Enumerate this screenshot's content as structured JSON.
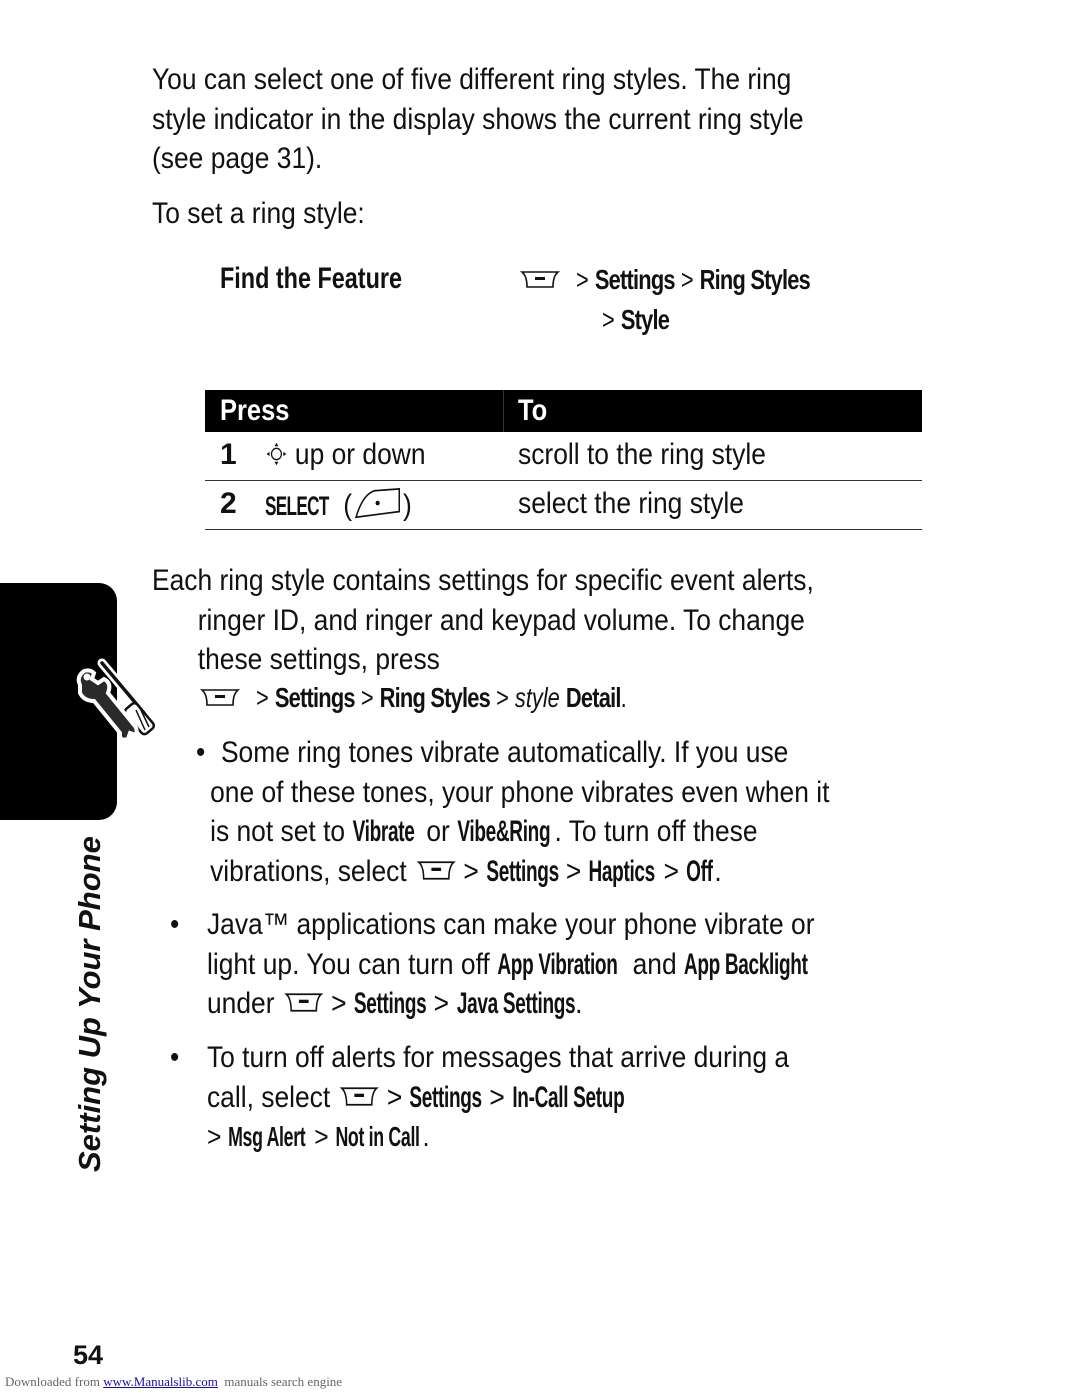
{
  "intro": {
    "lines": [
      "You can select one of five different ring styles. The ring",
      "style indicator in the display shows the current ring style",
      "(see page 31)."
    ],
    "lead": "To set a ring style:"
  },
  "find_feature": {
    "label": "Find the Feature",
    "menu_icon": "menu-key-icon",
    "path": [
      "Settings",
      "Ring Styles",
      "Style"
    ],
    "separator": ">"
  },
  "table": {
    "headers": [
      "Press",
      "To"
    ],
    "rows": [
      {
        "num": "1",
        "icon": "nav-key-icon",
        "press": "up or down",
        "to": "scroll to the ring style"
      },
      {
        "num": "2",
        "press_term": "SELECT",
        "icon": "select-key-icon",
        "open_paren": "(",
        "close_paren": ")",
        "to": "select the ring style"
      }
    ]
  },
  "details": {
    "lines": [
      "Each ring style contains settings for specific event alerts,",
      "ringer ID, and ringer and keypad volume. To change",
      "these settings, press"
    ],
    "path": [
      "Settings",
      "Ring Styles"
    ],
    "path_italic": "style",
    "path_end": "Detail",
    "period": "."
  },
  "bullets": [
    {
      "lines": [
        "Some ring tones vibrate automatically. If you use",
        "one of these tones, your phone vibrates even when it"
      ],
      "line3_pre": "is not set to ",
      "term1": "Vibrate",
      "mid": " or ",
      "term2": "Vibe&Ring",
      "line3_post": ". To turn off these",
      "line4_pre": "vibrations, select ",
      "path": [
        "Settings",
        "Haptics",
        "Off"
      ]
    },
    {
      "line1": "Java™ applications can make your phone vibrate or",
      "line2_pre": "light up. You can turn off ",
      "term1": "App Vibration",
      "mid": " and ",
      "term2": "App Backlight",
      "line3_pre": "under ",
      "path": [
        "Settings",
        "Java Settings"
      ]
    },
    {
      "line1": "To turn off alerts for messages that arrive during a",
      "line2_pre": "call, select ",
      "path": [
        "Settings",
        "In-Call Setup",
        "Msg Alert",
        "Not in Call"
      ]
    }
  ],
  "sidebar": {
    "section_title": "Setting Up Your Phone",
    "icon": "tools-icon"
  },
  "page_number": "54",
  "footer": {
    "pre": "Downloaded from ",
    "link": "www.Manualslib.com",
    "post": "  manuals search engine"
  }
}
